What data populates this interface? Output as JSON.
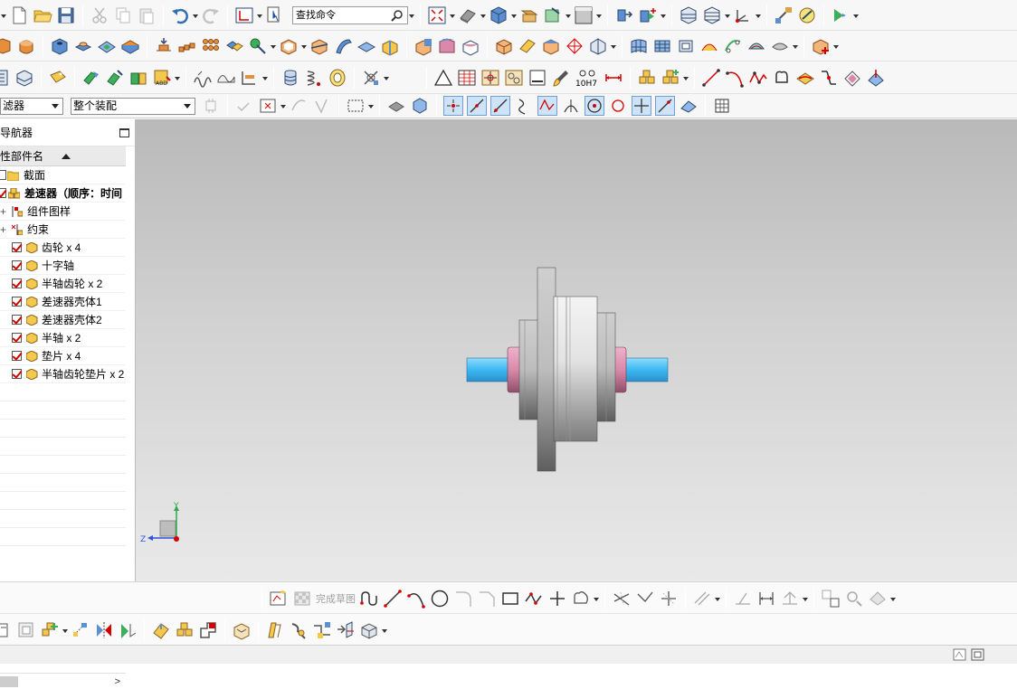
{
  "toolbar": {
    "search_placeholder": "查找命令"
  },
  "selection_bar": {
    "filter_value": "滤器",
    "scope_value": "整个装配"
  },
  "navigator": {
    "title": "导航器",
    "column_header": "性部件名",
    "items": [
      {
        "label": "截面"
      },
      {
        "label": "差速器（顺序：时间"
      },
      {
        "label": "组件图样"
      },
      {
        "label": "约束"
      },
      {
        "label": "齿轮 x 4"
      },
      {
        "label": "十字轴"
      },
      {
        "label": "半轴齿轮 x 2"
      },
      {
        "label": "差速器壳体1"
      },
      {
        "label": "差速器壳体2"
      },
      {
        "label": "半轴 x 2"
      },
      {
        "label": "垫片 x 4"
      },
      {
        "label": "半轴齿轮垫片 x 2"
      }
    ]
  },
  "triad": {
    "y_label": "Y",
    "z_label": "Z"
  },
  "sketch_toolbar": {
    "finish_sketch_label": "完成草图"
  },
  "toolbar_row3": {
    "tolerance_label": "10H7"
  },
  "colors": {
    "shaft_blue": "#4fc3f7",
    "washer_pink": "#d98aa9",
    "housing_gray": "#a8a8a8",
    "check_red": "#d40000",
    "folder_yellow": "#f2c94c"
  }
}
